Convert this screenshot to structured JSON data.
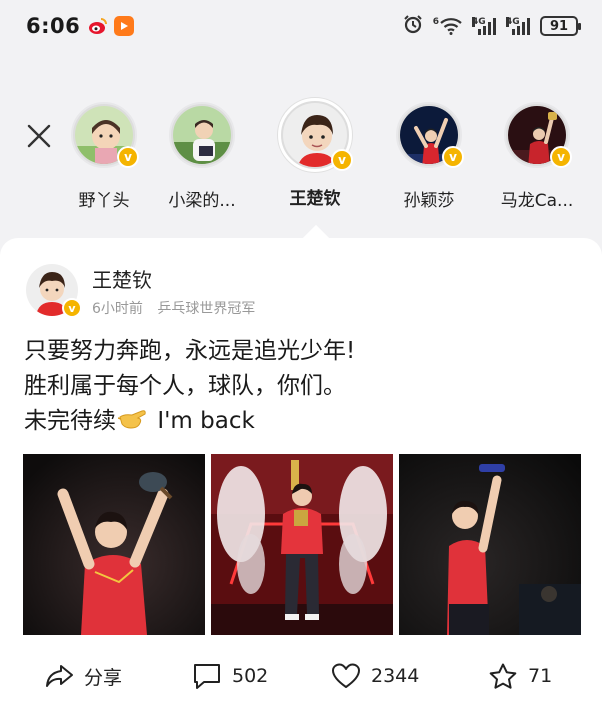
{
  "status_bar": {
    "time": "6:06",
    "network_1": "4G",
    "network_2": "4G",
    "wifi_label": "6",
    "battery": "91"
  },
  "stories": [
    {
      "name": "野丫头",
      "active": false
    },
    {
      "name": "小梁的...",
      "active": false
    },
    {
      "name": "王楚钦",
      "active": true
    },
    {
      "name": "孙颖莎",
      "active": false
    },
    {
      "name": "马龙Ca...",
      "active": false
    }
  ],
  "post": {
    "author": "王楚钦",
    "time_ago": "6小时前",
    "author_title": "乒乓球世界冠军",
    "line1": "只要努力奔跑，永远是追光少年!",
    "line2": "胜利属于每个人，球队，你们。",
    "line3_prefix": "未完待续",
    "line3_suffix": "I'm back"
  },
  "actions": {
    "share_label": "分享",
    "comments": "502",
    "likes": "2344",
    "favorites": "71"
  },
  "colors": {
    "verified_badge": "#f5b400",
    "page_bg": "#f2f2f4"
  }
}
